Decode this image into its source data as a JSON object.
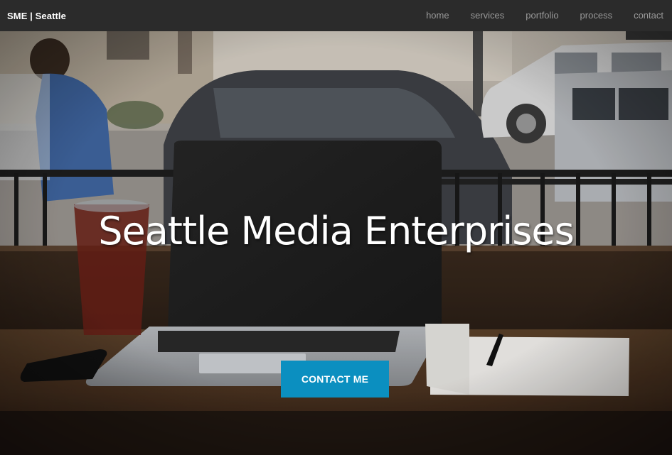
{
  "navbar": {
    "brand": "SME | Seattle",
    "links": [
      {
        "label": "home"
      },
      {
        "label": "services"
      },
      {
        "label": "portfolio"
      },
      {
        "label": "process"
      },
      {
        "label": "contact"
      }
    ]
  },
  "hero": {
    "title": "Seattle Media Enterprises",
    "cta_label": "CONTACT ME",
    "background_image": "cafe-laptop-photo"
  },
  "colors": {
    "navbar_bg": "#2b2b2b",
    "brand_text": "#ffffff",
    "nav_link": "#9a9a9a",
    "cta_bg": "#0b8fc0",
    "cta_text": "#ffffff"
  }
}
